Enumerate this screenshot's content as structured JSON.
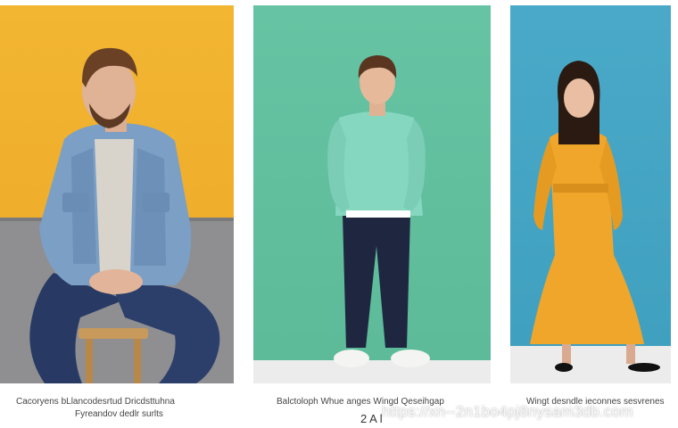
{
  "captions": {
    "panel_1_line_1": "Cacoryens  bLlancodesrtud  Dricdsttuhna",
    "panel_1_line_2": "Fyreandov dedlr surlts",
    "panel_2_line_1": "Balctoloph  Whue anges  Wingd Qeseihgap",
    "panel_2_number": "2 A l",
    "panel_3_line_1": "Wingt desndle ieconnes sesvrenes"
  },
  "watermark": "https://xn--2n1bo4pj8nysam3db.com",
  "colors": {
    "panel_1_bg": "#f2b632",
    "panel_2_bg": "#5fbd9a",
    "panel_3_bg": "#45a5c5",
    "jacket": "#7c9fc6",
    "sweater": "#86d7c0",
    "coat": "#f0a62a"
  }
}
